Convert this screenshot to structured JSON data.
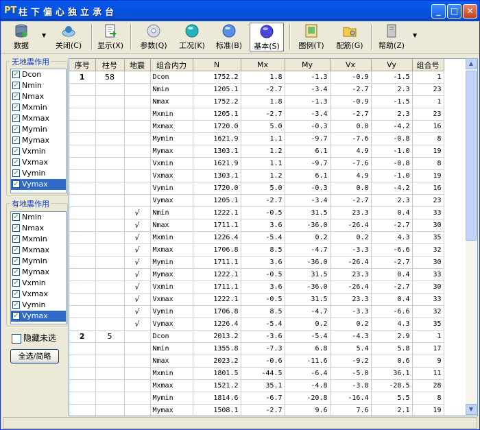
{
  "title": {
    "logo": "PT",
    "text": "柱下偏心独立承台"
  },
  "window_controls": {
    "minimize": "_",
    "maximize": "□",
    "close": "✕"
  },
  "toolbar": {
    "data": "数据",
    "close": "关闭(C)",
    "display": "显示(X)",
    "params": "参数(Q)",
    "case": "工况(K)",
    "standard": "标准(B)",
    "basic": "基本(S)",
    "legend": "图例(T)",
    "rebar": "配筋(G)",
    "help": "帮助(Z)"
  },
  "no_quake": {
    "title": "无地震作用",
    "items": [
      "Dcon",
      "Nmin",
      "Nmax",
      "Mxmin",
      "Mxmax",
      "Mymin",
      "Mymax",
      "Vxmin",
      "Vxmax",
      "Vymin",
      "Vymax"
    ],
    "selected": "Vymax"
  },
  "quake": {
    "title": "有地震作用",
    "items": [
      "Nmin",
      "Nmax",
      "Mxmin",
      "Mxmax",
      "Mymin",
      "Mymax",
      "Vxmin",
      "Vxmax",
      "Vymin",
      "Vymax"
    ],
    "selected": "Vymax"
  },
  "hide_unselected": "隐藏未选",
  "select_all_button": "全选/简略",
  "check_mark": "✓",
  "table": {
    "headers": [
      "序号",
      "柱号",
      "地震",
      "组合内力",
      "N",
      "Mx",
      "My",
      "Vx",
      "Vy",
      "组合号"
    ],
    "rows": [
      [
        "1",
        "58",
        "",
        "Dcon",
        "1752.2",
        "1.8",
        "-1.3",
        "-0.9",
        "-1.5",
        "1"
      ],
      [
        "",
        "",
        "",
        "Nmin",
        "1205.1",
        "-2.7",
        "-3.4",
        "-2.7",
        "2.3",
        "23"
      ],
      [
        "",
        "",
        "",
        "Nmax",
        "1752.2",
        "1.8",
        "-1.3",
        "-0.9",
        "-1.5",
        "1"
      ],
      [
        "",
        "",
        "",
        "Mxmin",
        "1205.1",
        "-2.7",
        "-3.4",
        "-2.7",
        "2.3",
        "23"
      ],
      [
        "",
        "",
        "",
        "Mxmax",
        "1720.0",
        "5.0",
        "-0.3",
        "0.0",
        "-4.2",
        "16"
      ],
      [
        "",
        "",
        "",
        "Mymin",
        "1621.9",
        "1.1",
        "-9.7",
        "-7.6",
        "-0.8",
        "8"
      ],
      [
        "",
        "",
        "",
        "Mymax",
        "1303.1",
        "1.2",
        "6.1",
        "4.9",
        "-1.0",
        "19"
      ],
      [
        "",
        "",
        "",
        "Vxmin",
        "1621.9",
        "1.1",
        "-9.7",
        "-7.6",
        "-0.8",
        "8"
      ],
      [
        "",
        "",
        "",
        "Vxmax",
        "1303.1",
        "1.2",
        "6.1",
        "4.9",
        "-1.0",
        "19"
      ],
      [
        "",
        "",
        "",
        "Vymin",
        "1720.0",
        "5.0",
        "-0.3",
        "0.0",
        "-4.2",
        "16"
      ],
      [
        "",
        "",
        "",
        "Vymax",
        "1205.1",
        "-2.7",
        "-3.4",
        "-2.7",
        "2.3",
        "23"
      ],
      [
        "",
        "",
        "√",
        "Nmin",
        "1222.1",
        "-0.5",
        "31.5",
        "23.3",
        "0.4",
        "33"
      ],
      [
        "",
        "",
        "√",
        "Nmax",
        "1711.1",
        "3.6",
        "-36.0",
        "-26.4",
        "-2.7",
        "30"
      ],
      [
        "",
        "",
        "√",
        "Mxmin",
        "1226.4",
        "-5.4",
        "0.2",
        "0.2",
        "4.3",
        "35"
      ],
      [
        "",
        "",
        "√",
        "Mxmax",
        "1706.8",
        "8.5",
        "-4.7",
        "-3.3",
        "-6.6",
        "32"
      ],
      [
        "",
        "",
        "√",
        "Mymin",
        "1711.1",
        "3.6",
        "-36.0",
        "-26.4",
        "-2.7",
        "30"
      ],
      [
        "",
        "",
        "√",
        "Mymax",
        "1222.1",
        "-0.5",
        "31.5",
        "23.3",
        "0.4",
        "33"
      ],
      [
        "",
        "",
        "√",
        "Vxmin",
        "1711.1",
        "3.6",
        "-36.0",
        "-26.4",
        "-2.7",
        "30"
      ],
      [
        "",
        "",
        "√",
        "Vxmax",
        "1222.1",
        "-0.5",
        "31.5",
        "23.3",
        "0.4",
        "33"
      ],
      [
        "",
        "",
        "√",
        "Vymin",
        "1706.8",
        "8.5",
        "-4.7",
        "-3.3",
        "-6.6",
        "32"
      ],
      [
        "",
        "",
        "√",
        "Vymax",
        "1226.4",
        "-5.4",
        "0.2",
        "0.2",
        "4.3",
        "35"
      ],
      [
        "2",
        "5",
        "",
        "Dcon",
        "2013.2",
        "-3.6",
        "-5.4",
        "-4.3",
        "2.9",
        "1"
      ],
      [
        "",
        "",
        "",
        "Nmin",
        "1355.8",
        "-7.3",
        "6.8",
        "5.4",
        "5.8",
        "17"
      ],
      [
        "",
        "",
        "",
        "Nmax",
        "2023.2",
        "-0.6",
        "-11.6",
        "-9.2",
        "0.6",
        "9"
      ],
      [
        "",
        "",
        "",
        "Mxmin",
        "1801.5",
        "-44.5",
        "-6.4",
        "-5.0",
        "36.1",
        "11"
      ],
      [
        "",
        "",
        "",
        "Mxmax",
        "1521.2",
        "35.1",
        "-4.8",
        "-3.8",
        "-28.5",
        "28"
      ],
      [
        "",
        "",
        "",
        "Mymin",
        "1814.6",
        "-6.7",
        "-20.8",
        "-16.4",
        "5.5",
        "8"
      ],
      [
        "",
        "",
        "",
        "Mymax",
        "1508.1",
        "-2.7",
        "9.6",
        "7.6",
        "2.1",
        "19"
      ]
    ]
  },
  "scroll": {
    "up": "▲",
    "down": "▼"
  }
}
